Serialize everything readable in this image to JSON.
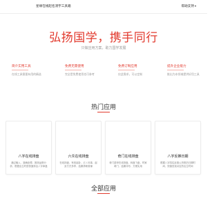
{
  "header": {
    "brand": "星缘在线起名测字工具箱",
    "help_link": "帮助支持"
  },
  "hero": {
    "title": "弘扬国学，携手同行",
    "subtitle": "只做应用方案，助力国学发展"
  },
  "features": [
    {
      "title": "简介实用工具",
      "desc": "在线工具需要有用的精选"
    },
    {
      "title": "免费无需使用",
      "desc": "完全是免费使用也可参考"
    },
    {
      "title": "免费订制应用",
      "desc": "仅此需求，可以定制"
    },
    {
      "title": "提升企业能力",
      "desc": "推出为本领域提供好用工具"
    }
  ],
  "hot_section": {
    "title": "热门应用"
  },
  "hot_apps": [
    {
      "title": "八字在线排盘",
      "desc": "通过输入、准确处理、推测运势分析，根据出生时辰快速排出八字命盘"
    },
    {
      "title": "六爻在线排盘",
      "desc": "在线排盘，有效起卦，占卜问事，起卦方式多样，结果清晰易懂"
    },
    {
      "title": "奇门在线排盘",
      "desc": "奇门遁甲在线排盘，转盘飞盘，时家奇门，结果详尽，方便实用"
    },
    {
      "title": "八字反推日期",
      "desc": "根据八字四柱反推公历阳历日期时间，快速查找对应的出生时间"
    }
  ],
  "all_section": {
    "title": "全部应用"
  }
}
